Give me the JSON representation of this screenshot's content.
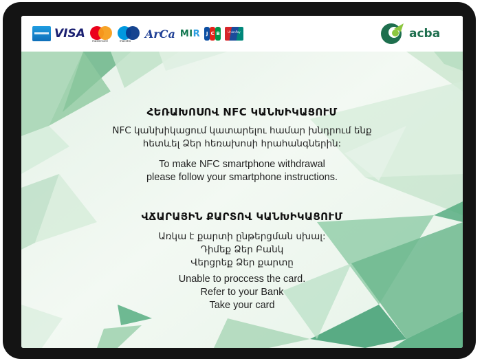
{
  "payment_logos": {
    "amex": "american-express-logo",
    "visa": "VISA",
    "mastercard": "mastercard",
    "maestro": "maestro",
    "arca": "ArCa",
    "mir_left": "MI",
    "mir_right": "R",
    "jcb_letters": [
      "J",
      "C",
      "B"
    ],
    "unionpay_line1": "UnionPay",
    "unionpay_line2": "银联"
  },
  "bank": {
    "name": "acba",
    "logo_icon": "acba-logo-icon",
    "brand_color": "#1e6f4e",
    "accent_color": "#8cc63f"
  },
  "nfc": {
    "title_hy": "ՀԵՌԱԽՈՍՈՎ NFC ԿԱՆԽԻԿԱՑՈՒՄ",
    "text_hy_1": "NFC կանխիկացում կատարելու համար խնդրում ենք",
    "text_hy_2": "հետևել Ձեր հեռախոսի հրահանգներին:",
    "text_en_1": "To make NFC smartphone withdrawal",
    "text_en_2": "please follow your smartphone instructions."
  },
  "card": {
    "title_hy": "ՎՃԱՐԱՅԻՆ ՔԱՐՏՈՎ ԿԱՆԽԻԿԱՑՈՒՄ",
    "text_hy_1": "Առկա է քարտի ընթերցման սխալ:",
    "text_hy_2": "Դիմեք Ձեր Բանկ",
    "text_hy_3": "Վերցրեք Ձեր քարտը",
    "text_en_1": "Unable to proccess the card.",
    "text_en_2": "Refer to your Bank",
    "text_en_3": "Take your card"
  },
  "colors": {
    "bezel": "#141414",
    "background_tint": "#eaf4ea",
    "polygon_dark": "#5aa67a",
    "polygon_light": "#c8e6cf"
  }
}
